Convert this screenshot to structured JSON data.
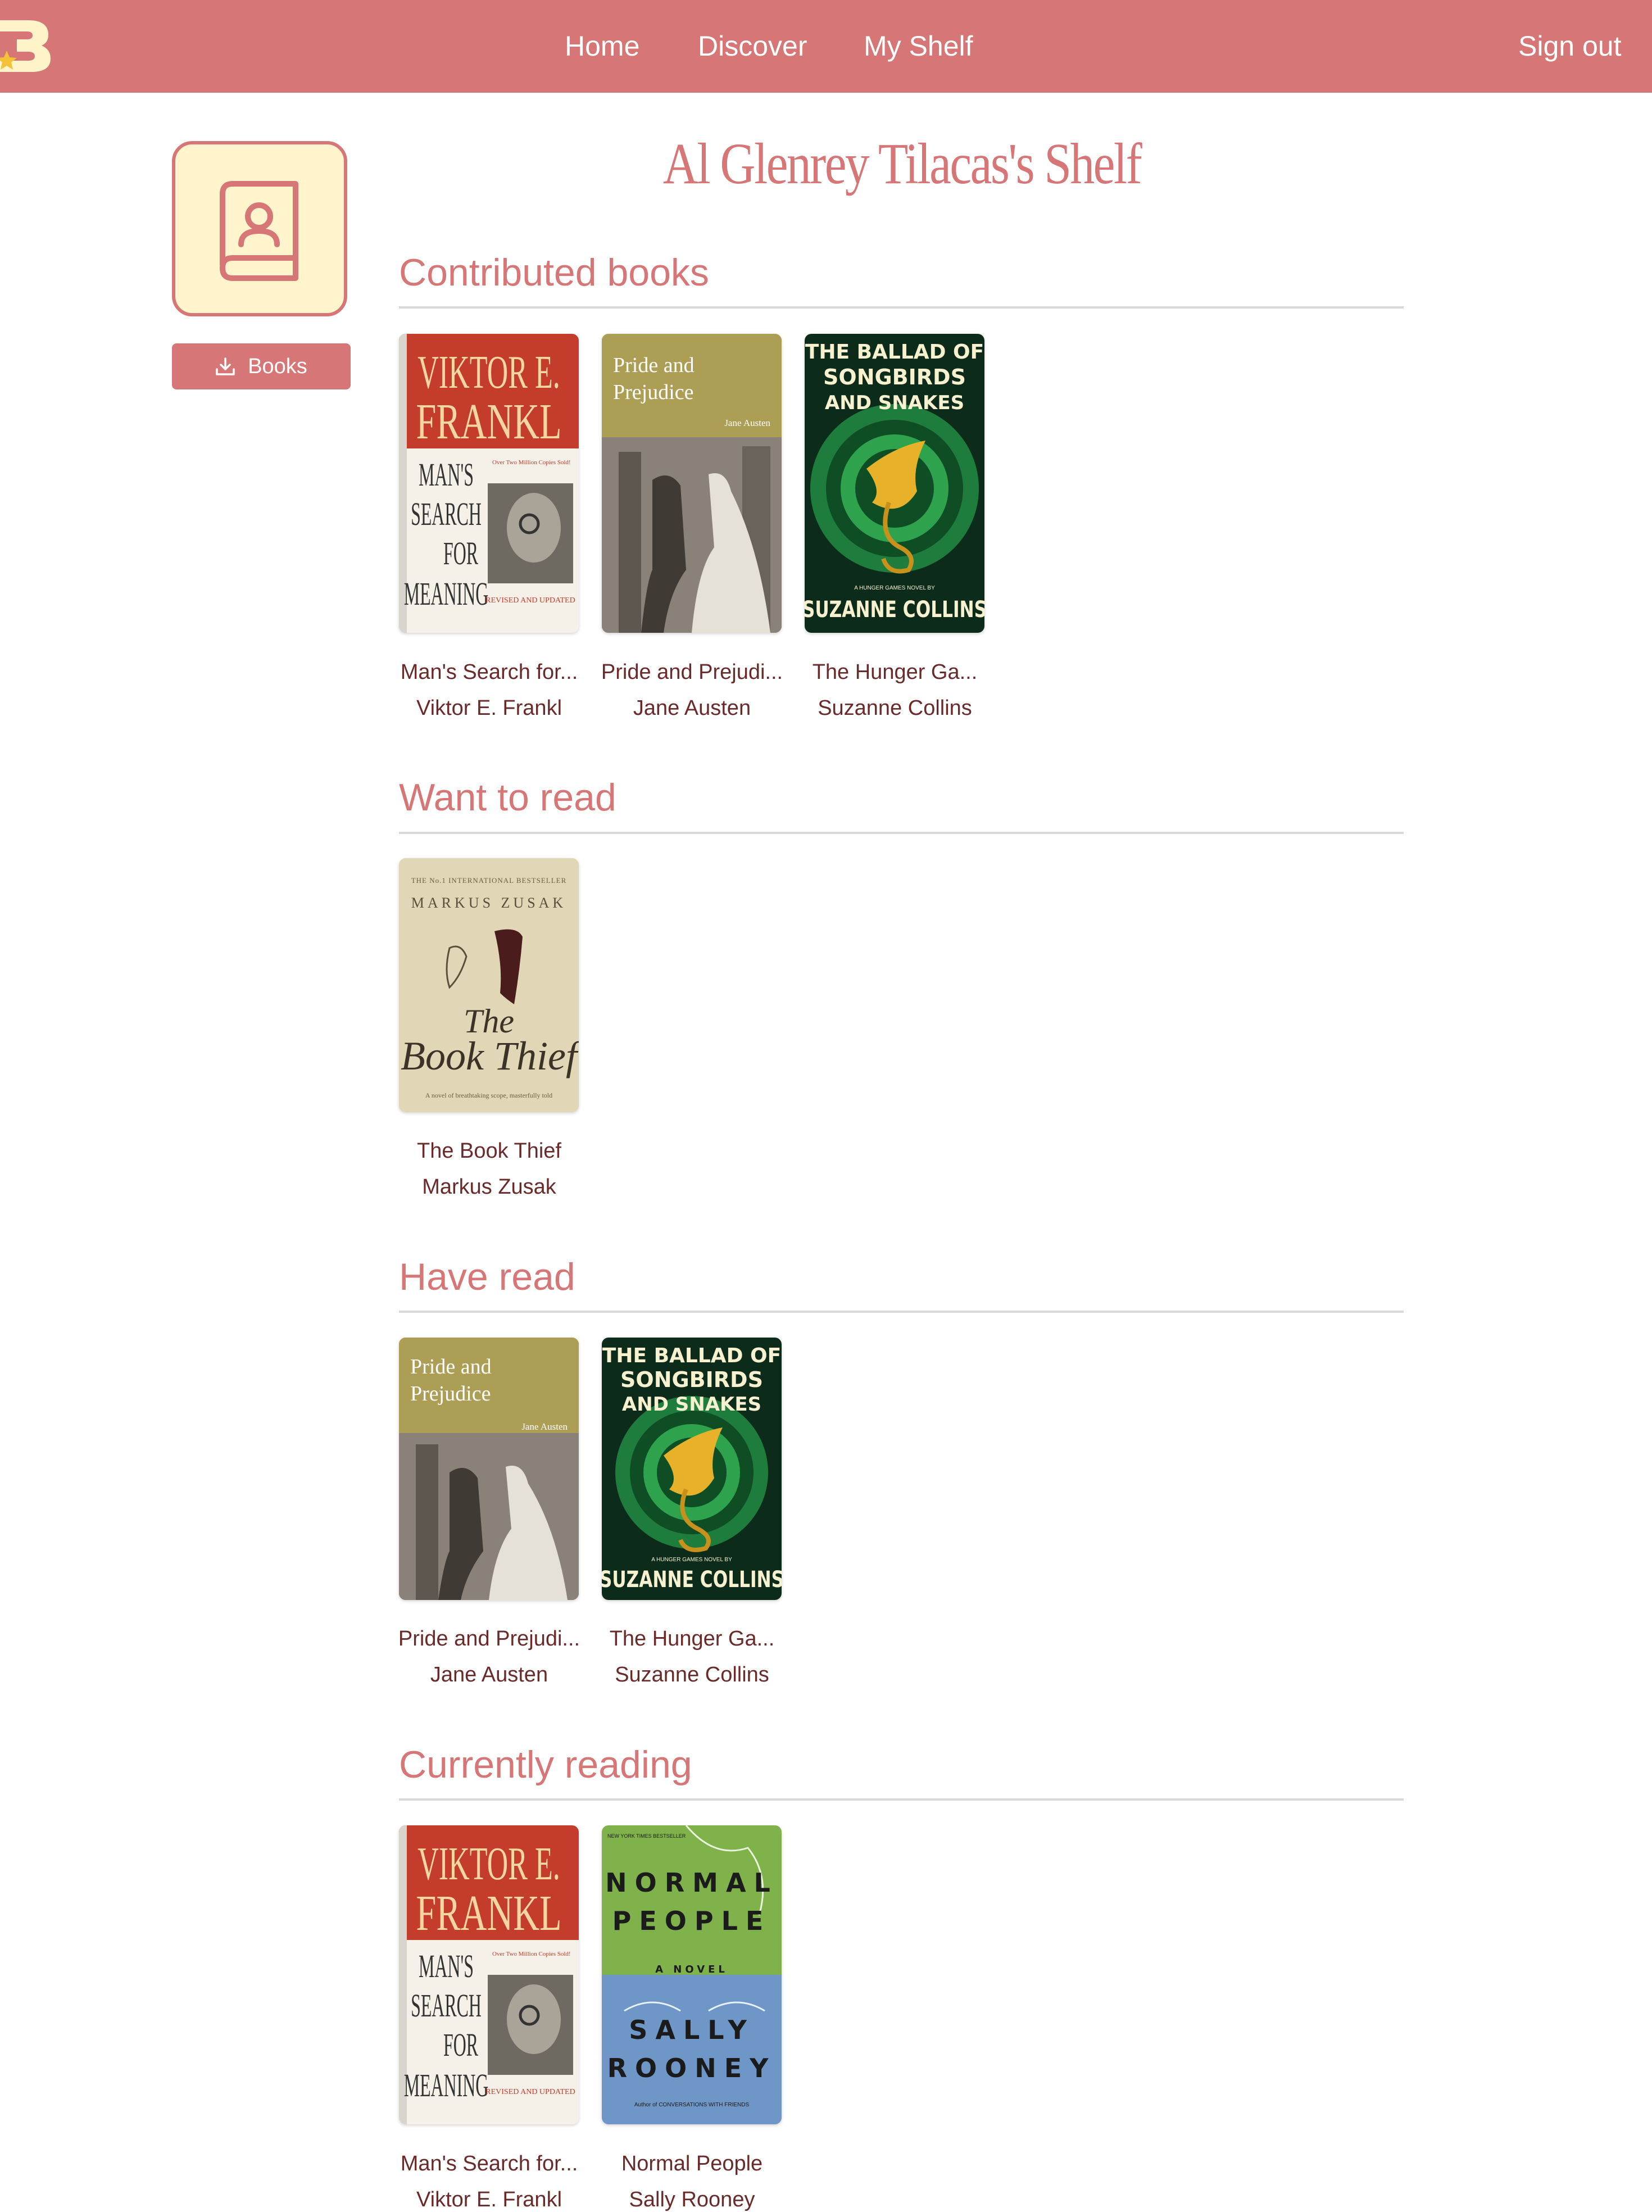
{
  "nav": {
    "home": "Home",
    "discover": "Discover",
    "my_shelf": "My Shelf",
    "sign_out": "Sign out"
  },
  "sidebar": {
    "books_button": "Books"
  },
  "page_title": "Al Glenrey Tilacas's Shelf",
  "sections": {
    "contributed": {
      "title": "Contributed books",
      "books": [
        {
          "title": "Man's Search for...",
          "author": "Viktor E. Frankl"
        },
        {
          "title": "Pride and Prejudi...",
          "author": "Jane Austen"
        },
        {
          "title": "The Hunger Ga...",
          "author": "Suzanne Collins"
        }
      ]
    },
    "want_to_read": {
      "title": "Want to read",
      "books": [
        {
          "title": "The Book Thief",
          "author": "Markus Zusak"
        }
      ]
    },
    "have_read": {
      "title": "Have read",
      "books": [
        {
          "title": "Pride and Prejudi...",
          "author": "Jane Austen"
        },
        {
          "title": "The Hunger Ga...",
          "author": "Suzanne Collins"
        }
      ]
    },
    "currently_reading": {
      "title": "Currently reading",
      "books": [
        {
          "title": "Man's Search for...",
          "author": "Viktor E. Frankl"
        },
        {
          "title": "Normal People",
          "author": "Sally Rooney"
        }
      ]
    }
  },
  "covers": {
    "mans_search": {
      "l1": "VIKTOR E.",
      "l2": "FRANKL",
      "t1": "MAN'S",
      "t2": "SEARCH",
      "t3": "FOR",
      "t4": "MEANING",
      "blurb": "Over Two Million Copies Sold!",
      "edition": "REVISED AND UPDATED"
    },
    "pride": {
      "t1": "Pride and",
      "t2": "Prejudice",
      "author": "Jane Austen"
    },
    "ballad": {
      "t1": "THE BALLAD OF",
      "t2": "SONGBIRDS",
      "t3": "AND SNAKES",
      "tag": "A HUNGER GAMES NOVEL BY",
      "author": "SUZANNE COLLINS"
    },
    "book_thief": {
      "top": "THE No.1 INTERNATIONAL BESTSELLER",
      "author": "MARKUS ZUSAK",
      "t1": "The",
      "t2": "Book Thief",
      "tag": "A novel of breathtaking scope, masterfully told"
    },
    "normal_people": {
      "nyt": "NEW YORK TIMES BESTSELLER",
      "t1": "NORMAL",
      "t2": "PEOPLE",
      "sub": "A NOVEL",
      "a1": "SALLY",
      "a2": "ROONEY",
      "foot": "Author of CONVERSATIONS WITH FRIENDS"
    }
  },
  "colors": {
    "brand": "#d77676",
    "avatar_bg": "#fff4cc",
    "text": "#6b2a2a"
  }
}
